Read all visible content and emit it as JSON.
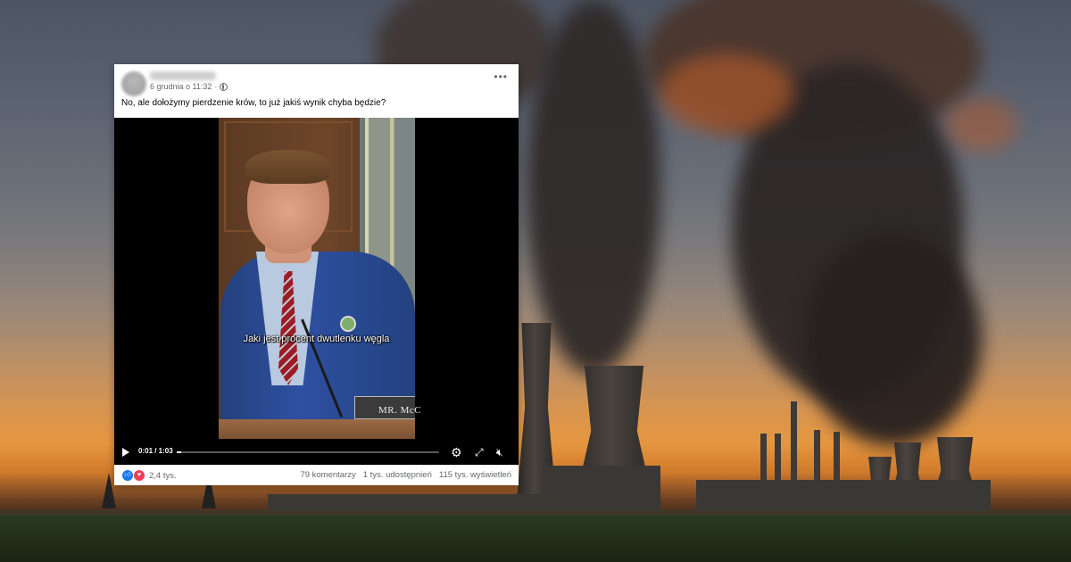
{
  "post": {
    "date": "6 grudnia o 11:32",
    "text": "No, ale dołożymy pierdzenie krów, to już jakiś wynik chyba będzie?",
    "more_icon": "more-options-icon",
    "privacy_icon": "globe-icon"
  },
  "video": {
    "subtitle": "Jaki jest procent dwutlenku węgla",
    "nameplate": "MR. McC",
    "time": "0:01 / 1:03",
    "progress_fraction": 0.016,
    "icons": [
      "play-icon",
      "gear-icon",
      "fullscreen-icon",
      "volume-muted-icon"
    ]
  },
  "footer": {
    "reactions": "2,4 tys.",
    "comments": "79 komentarzy",
    "shares": "1 tys. udostępnień",
    "views": "115 tys. wyświetleń"
  },
  "colors": {
    "like_blue": "#1877f2",
    "love_red": "#f33e58",
    "meta_gray": "#65676b"
  }
}
